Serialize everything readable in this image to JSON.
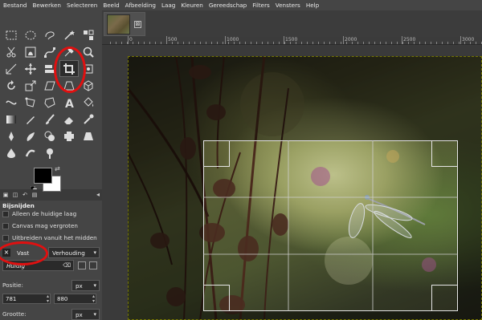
{
  "menubar": {
    "items": [
      "Bestand",
      "Bewerken",
      "Selecteren",
      "Beeld",
      "Afbeelding",
      "Laag",
      "Kleuren",
      "Gereedschap",
      "Filters",
      "Vensters",
      "Help"
    ]
  },
  "image_tab": {
    "close_glyph": "⊠"
  },
  "rulers": {
    "top_labels": [
      "0",
      "500",
      "1000",
      "1500",
      "2000",
      "2500",
      "3000"
    ]
  },
  "tool_options": {
    "title": "Bijsnijden",
    "checkbox_current_layer": "Alleen de huidige laag",
    "checkbox_allow_growing": "Canvas mag vergroten",
    "checkbox_expand_center": "Uitbreiden vanuit het midden",
    "fixed_label": "Vast",
    "fixed_mode": "Verhouding",
    "aspect_value": "Huidig",
    "position_label": "Positie:",
    "position_unit": "px",
    "position_x": "781",
    "position_y": "880",
    "size_label": "Grootte:",
    "size_unit": "px"
  },
  "colors": {
    "foreground": "#000000",
    "background": "#ffffff",
    "annotation": "#e01010",
    "selection_marching_ants": "#d8d800"
  },
  "tools": [
    "rect-select-icon",
    "ellipse-select-icon",
    "free-select-icon",
    "fuzzy-select-icon",
    "by-color-select-icon",
    "scissors-select-icon",
    "foreground-select-icon",
    "paths-icon",
    "color-picker-icon",
    "zoom-icon",
    "measure-icon",
    "move-icon",
    "alignment-icon",
    "crop-icon",
    "unified-transform-icon",
    "rotate-icon",
    "scale-icon",
    "shear-icon",
    "perspective-icon",
    "3d-transform-icon",
    "warp-icon",
    "handle-transform-icon",
    "cage-icon",
    "text-icon",
    "bucket-fill-icon",
    "gradient-icon",
    "pencil-icon",
    "paintbrush-icon",
    "eraser-icon",
    "airbrush-icon",
    "ink-icon",
    "mypaint-brush-icon",
    "clone-icon",
    "heal-icon",
    "perspective-clone-icon",
    "blur-icon",
    "smudge-icon",
    "dodge-burn-icon"
  ]
}
